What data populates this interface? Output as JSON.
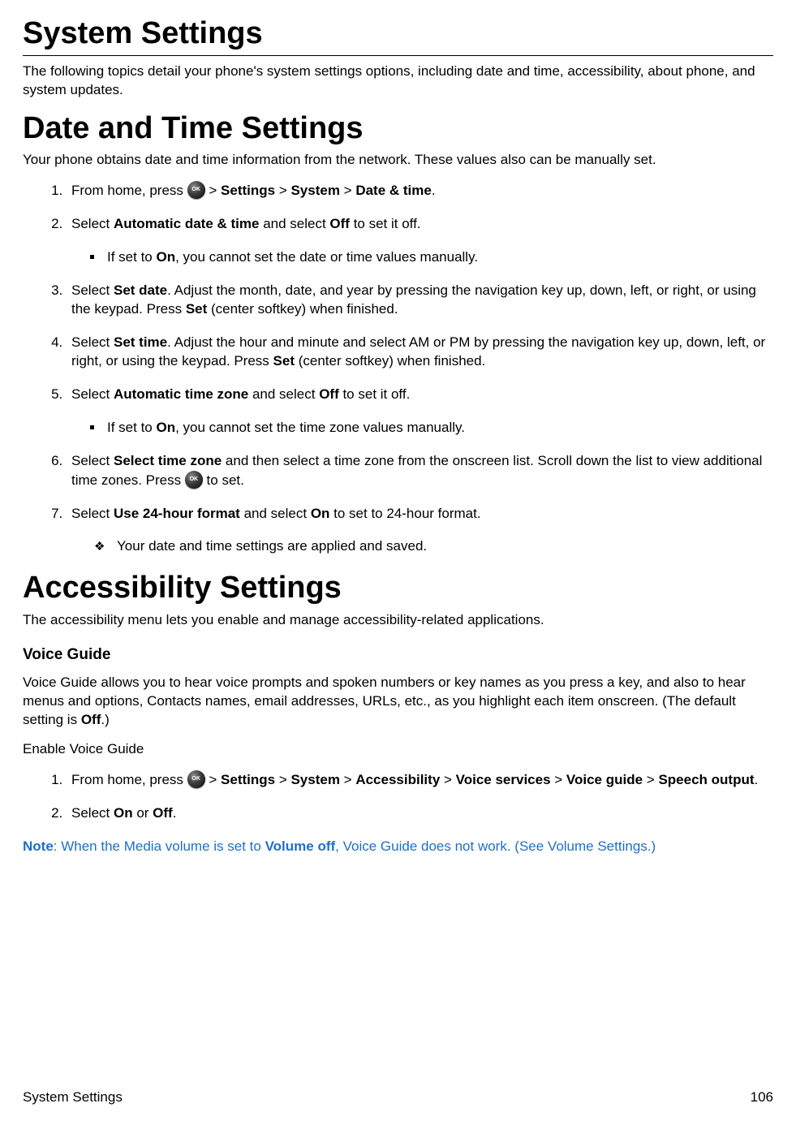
{
  "h1_system_settings": "System Settings",
  "intro_system": "The following topics detail your phone's system settings options, including date and time, accessibility, about phone, and system updates.",
  "h1_date_time": "Date and Time Settings",
  "intro_date_time": "Your phone obtains date and time information from the network. These values also can be manually set.",
  "dt": {
    "step1_a": "From home, press ",
    "step1_b": " > ",
    "step1_settings": "Settings",
    "step1_system": "System",
    "step1_datetime": "Date & time",
    "step1_end": ".",
    "step2_a": "Select ",
    "step2_auto": "Automatic date & time",
    "step2_b": " and select ",
    "step2_off": "Off",
    "step2_c": " to set it off.",
    "step2_sub_a": "If set to ",
    "step2_sub_on": "On",
    "step2_sub_b": ", you cannot set the date or time values manually.",
    "step3_a": "Select ",
    "step3_setdate": "Set date",
    "step3_b": ". Adjust the month, date, and year by pressing the navigation key up, down, left, or right, or using the keypad. Press ",
    "step3_set": "Set",
    "step3_c": " (center softkey) when finished.",
    "step4_a": "Select ",
    "step4_settime": "Set time",
    "step4_b": ". Adjust the hour and minute and select AM or PM by pressing the navigation key up, down, left, or right, or using the keypad. Press ",
    "step4_set": "Set",
    "step4_c": " (center softkey) when finished.",
    "step5_a": "Select ",
    "step5_autozone": "Automatic time zone",
    "step5_b": " and select ",
    "step5_off": "Off",
    "step5_c": " to set it off.",
    "step5_sub_a": "If set to ",
    "step5_sub_on": "On",
    "step5_sub_b": ", you cannot set the time zone values manually.",
    "step6_a": "Select ",
    "step6_selzone": "Select time zone",
    "step6_b": " and then select a time zone from the onscreen list. Scroll down the list to view additional time zones. Press ",
    "step6_c": " to set.",
    "step7_a": "Select ",
    "step7_24h": "Use 24-hour format",
    "step7_b": " and select ",
    "step7_on": "On",
    "step7_c": " to set to 24-hour format.",
    "step7_sub": "Your date and time settings are applied and saved."
  },
  "h1_accessibility": "Accessibility Settings",
  "intro_accessibility": "The accessibility menu lets you enable and manage accessibility-related applications.",
  "h2_voice_guide": "Voice Guide",
  "voice_guide_desc_a": "Voice Guide allows you to hear voice prompts and spoken numbers or key names as you press a key, and also to hear menus and options, Contacts names, email addresses, URLs, etc., as you highlight each item onscreen. (The default setting is ",
  "voice_guide_desc_off": "Off",
  "voice_guide_desc_b": ".)",
  "enable_voice_guide": "Enable Voice Guide",
  "vg": {
    "step1_a": "From home, press ",
    "step1_b": " > ",
    "settings": "Settings",
    "system": "System",
    "accessibility": "Accessibility",
    "voice_services": "Voice services",
    "voice_guide": "Voice guide",
    "speech_output": "Speech output",
    "step1_end": ".",
    "step2_a": "Select ",
    "step2_on": "On",
    "step2_or": " or ",
    "step2_off": "Off",
    "step2_end": "."
  },
  "note_label": "Note",
  "note_a": ": When the Media volume is set to ",
  "note_voloff": "Volume off",
  "note_b": ", Voice Guide does not work. (See ",
  "note_link": "Volume Settings",
  "note_c": ".)",
  "footer_left": "System Settings",
  "footer_right": "106"
}
